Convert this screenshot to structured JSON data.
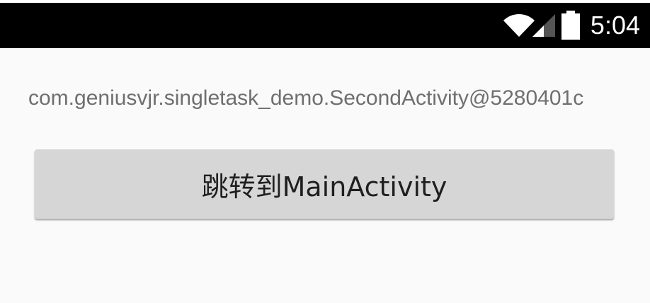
{
  "status_bar": {
    "time": "5:04",
    "icons": [
      "wifi-icon",
      "cell-signal-icon",
      "battery-icon"
    ]
  },
  "main": {
    "activity_text": "com.geniusvjr.singletask_demo.SecondActivity@5280401c",
    "button_label": "跳转到MainActivity"
  },
  "colors": {
    "status_bar_bg": "#000000",
    "background": "#fafafa",
    "text_secondary": "#6f6f6f",
    "button_bg": "#d6d6d6",
    "button_text": "#1f1f1f"
  }
}
